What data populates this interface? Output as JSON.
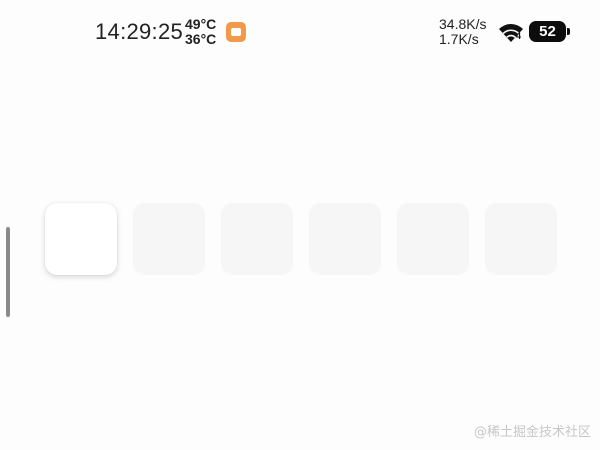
{
  "status_bar": {
    "time": "14:29:25",
    "temperature_high": "49°C",
    "temperature_low": "36°C",
    "notification_icon": "message-icon",
    "net_upload": "34.8K/s",
    "net_download": "1.7K/s",
    "wifi_icon": "wifi-icon",
    "wifi_badge": "4",
    "battery_level": "52",
    "colors": {
      "notification": "#f2994a",
      "battery": "#0d0d0d"
    }
  },
  "cards": {
    "items": [
      {
        "state": "active"
      },
      {
        "state": "inactive"
      },
      {
        "state": "inactive"
      },
      {
        "state": "inactive"
      },
      {
        "state": "inactive"
      },
      {
        "state": "inactive"
      }
    ]
  },
  "watermark": {
    "text": "@稀土掘金技术社区"
  }
}
